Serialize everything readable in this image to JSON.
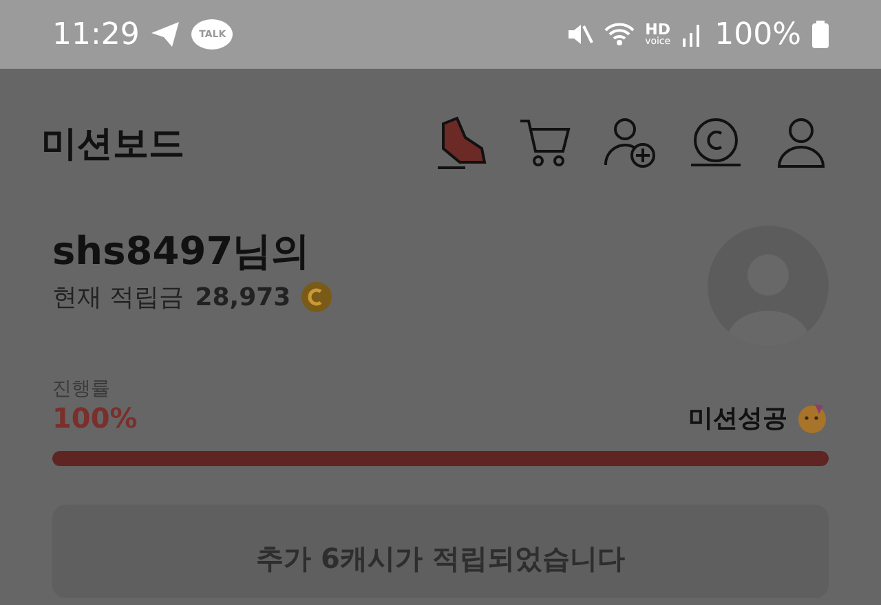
{
  "status_bar": {
    "time": "11:29",
    "talk_badge": "TALK",
    "hd_label": "HD",
    "voice_label": "voice",
    "battery": "100%"
  },
  "header": {
    "title": "미션보드"
  },
  "profile": {
    "greeting": "shs8497님의",
    "balance_label": "현재 적립금",
    "balance": "28,973"
  },
  "progress": {
    "label": "진행률",
    "percent": "100%",
    "status": "미션성공",
    "level": 1
  },
  "notice": {
    "text": "추가 6캐시가 적립되었습니다"
  }
}
